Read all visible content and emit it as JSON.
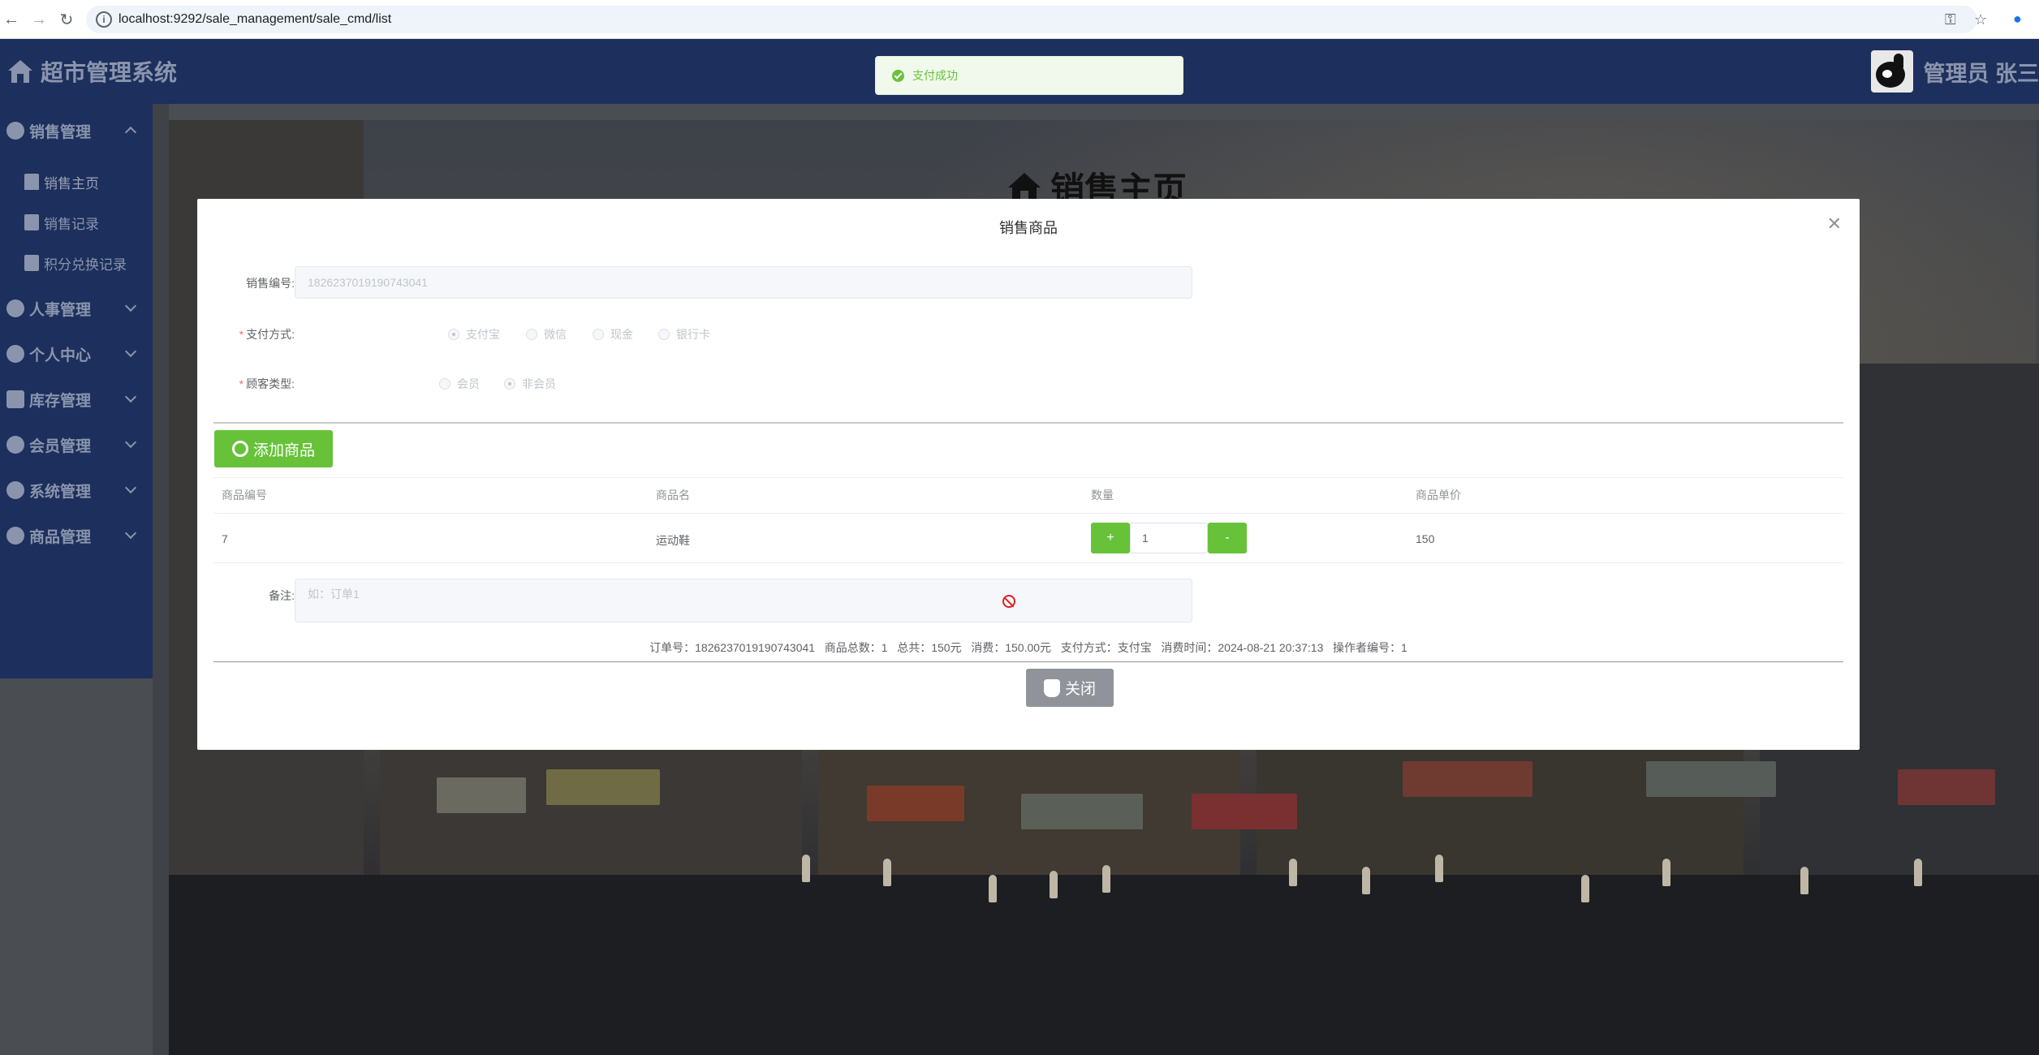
{
  "browser": {
    "url": "localhost:9292/sale_management/sale_cmd/list"
  },
  "header": {
    "app_title": "超市管理系统",
    "user_label": "管理员 张三"
  },
  "toast": {
    "message": "支付成功"
  },
  "sidebar": {
    "items": [
      {
        "label": "销售管理",
        "expanded": true,
        "children": [
          {
            "label": "销售主页"
          },
          {
            "label": "销售记录"
          },
          {
            "label": "积分兑换记录"
          }
        ]
      },
      {
        "label": "人事管理"
      },
      {
        "label": "个人中心"
      },
      {
        "label": "库存管理"
      },
      {
        "label": "会员管理"
      },
      {
        "label": "系统管理"
      },
      {
        "label": "商品管理"
      }
    ]
  },
  "page": {
    "title": "销售主页"
  },
  "modal": {
    "title": "销售商品",
    "sale_no_label": "销售编号:",
    "sale_no_value": "1826237019190743041",
    "payment_label": "支付方式:",
    "payment_options": [
      "支付宝",
      "微信",
      "现金",
      "银行卡"
    ],
    "payment_selected": "支付宝",
    "customer_label": "顾客类型:",
    "customer_options": [
      "会员",
      "非会员"
    ],
    "customer_selected": "非会员",
    "add_button": "添加商品",
    "table": {
      "headers": [
        "商品编号",
        "商品名",
        "数量",
        "商品单价"
      ],
      "rows": [
        {
          "id": "7",
          "name": "运动鞋",
          "qty": "1",
          "price": "150"
        }
      ],
      "plus": "+",
      "minus": "-"
    },
    "remark_label": "备注:",
    "remark_placeholder": "如：订单1",
    "summary": "订单号：1826237019190743041   商品总数：1   总共：150元   消费：150.00元   支付方式：支付宝   消费时间：2024-08-21 20:37:13   操作者编号：1",
    "close_button": "关闭"
  },
  "colors": {
    "primary_green": "#67c23a",
    "nav_dark": "#1d2f5c",
    "close_gray": "#909399"
  }
}
